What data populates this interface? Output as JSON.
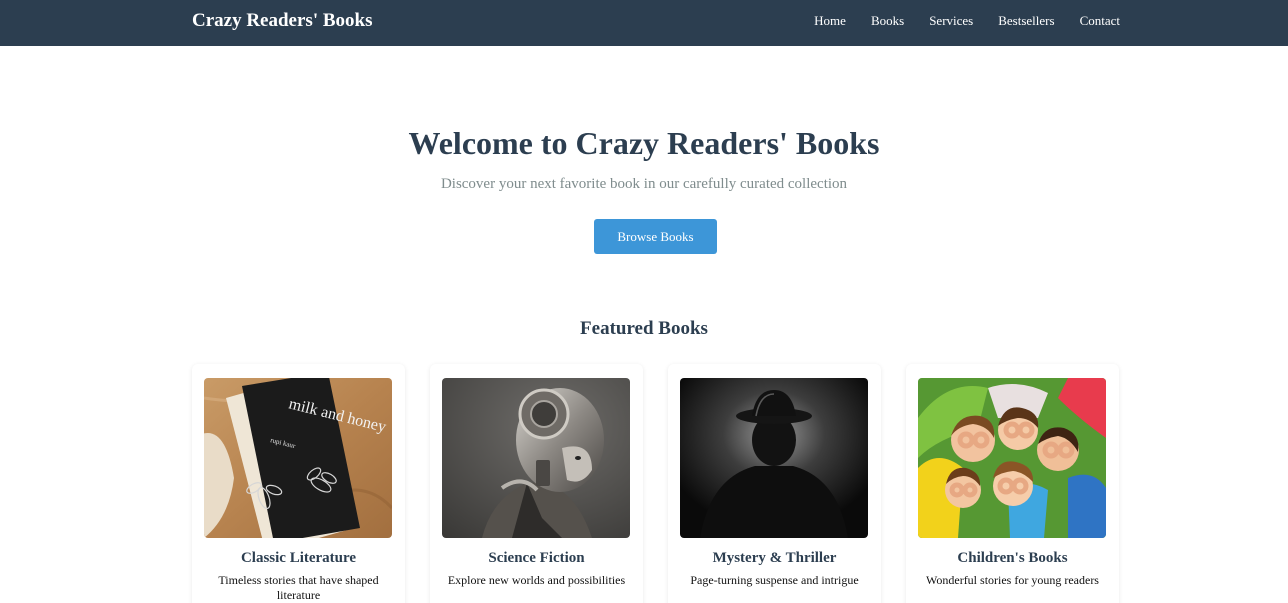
{
  "brand": "Crazy Readers' Books",
  "nav": [
    "Home",
    "Books",
    "Services",
    "Bestsellers",
    "Contact"
  ],
  "hero": {
    "title": "Welcome to Crazy Readers' Books",
    "subtitle": "Discover your next favorite book in our carefully curated collection",
    "button": "Browse Books"
  },
  "featured_title": "Featured Books",
  "cards": [
    {
      "title": "Classic Literature",
      "desc": "Timeless stories that have shaped literature",
      "book_title": "milk and honey",
      "book_author": "rupi kaur"
    },
    {
      "title": "Science Fiction",
      "desc": "Explore new worlds and possibilities"
    },
    {
      "title": "Mystery & Thriller",
      "desc": "Page-turning suspense and intrigue"
    },
    {
      "title": "Children's Books",
      "desc": "Wonderful stories for young readers"
    }
  ],
  "colors": {
    "nav_bg": "#2c3e50",
    "accent": "#3d96d8",
    "heading": "#2c3e50",
    "muted": "#7f8c8d"
  }
}
